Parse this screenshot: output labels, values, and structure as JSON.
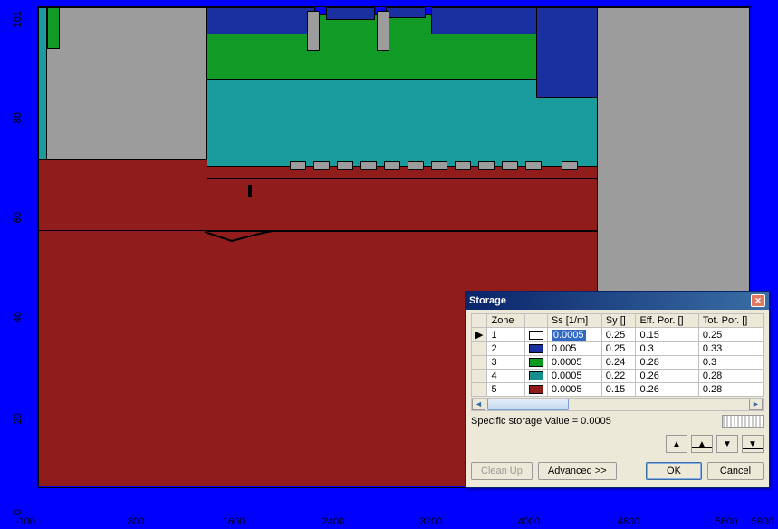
{
  "axes": {
    "y": [
      "101",
      "80",
      "60",
      "40",
      "20",
      "0"
    ],
    "x": [
      "-100",
      "800",
      "1600",
      "2400",
      "3200",
      "4000",
      "4800",
      "5600",
      "5900"
    ]
  },
  "dialog": {
    "title": "Storage",
    "headers": {
      "zone": "Zone",
      "ss": "Ss [1/m]",
      "sy": "Sy []",
      "effpor": "Eff. Por. []",
      "totpor": "Tot. Por. []"
    },
    "rows": [
      {
        "zone": "1",
        "color": "#FFFFFF",
        "ss": "0.0005",
        "sy": "0.25",
        "effpor": "0.15",
        "totpor": "0.25",
        "current": true,
        "selected_ss": true
      },
      {
        "zone": "2",
        "color": "#1C2F9E",
        "ss": "0.005",
        "sy": "0.25",
        "effpor": "0.3",
        "totpor": "0.33"
      },
      {
        "zone": "3",
        "color": "#0E9A1F",
        "ss": "0.0005",
        "sy": "0.24",
        "effpor": "0.28",
        "totpor": "0.3"
      },
      {
        "zone": "4",
        "color": "#178F8F",
        "ss": "0.0005",
        "sy": "0.22",
        "effpor": "0.26",
        "totpor": "0.28"
      },
      {
        "zone": "5",
        "color": "#8F1B1B",
        "ss": "0.0005",
        "sy": "0.15",
        "effpor": "0.26",
        "totpor": "0.28"
      }
    ],
    "status": "Specific storage Value = 0.0005",
    "buttons": {
      "cleanup": "Clean Up",
      "advanced": "Advanced >>",
      "ok": "OK",
      "cancel": "Cancel"
    }
  },
  "geology_colors": {
    "zone1": "#FFFFFF",
    "zone2": "#1A2FA0",
    "zone3": "#129A26",
    "zone4": "#1B9C9C",
    "zone5": "#911C1C",
    "inactive": "#9C9C9C"
  }
}
